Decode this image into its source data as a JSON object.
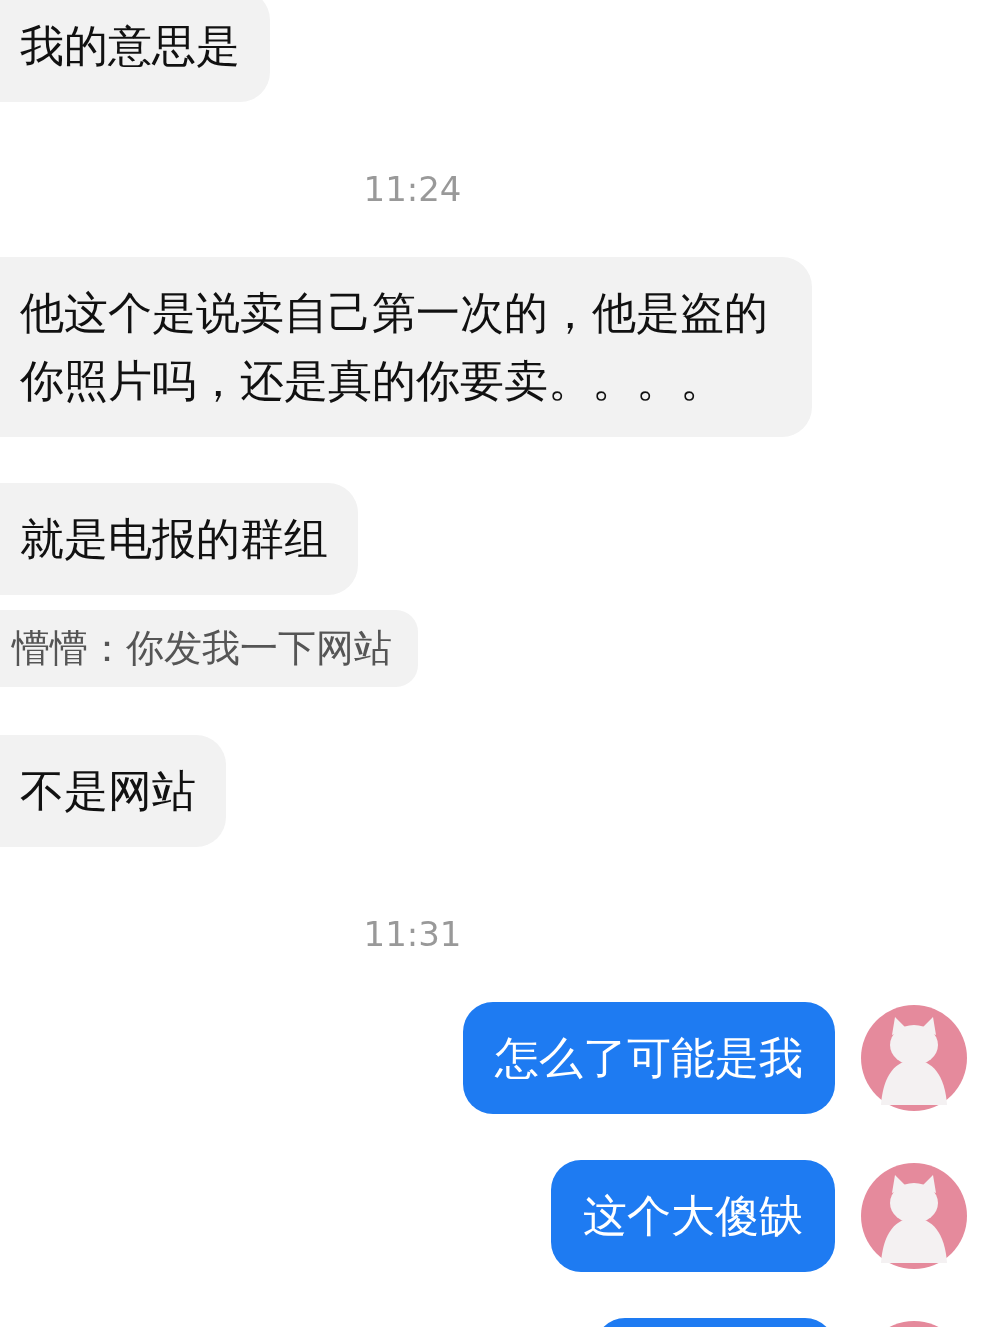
{
  "messages": [
    {
      "kind": "incoming",
      "text": "我的意思是"
    },
    {
      "kind": "time",
      "text": "11:24"
    },
    {
      "kind": "incoming",
      "text": "他这个是说卖自己第一次的，他是盗的你照片吗，还是真的你要卖。。。。"
    },
    {
      "kind": "incoming",
      "text": "就是电报的群组"
    },
    {
      "kind": "quote",
      "text": "懵懵：你发我一下网站"
    },
    {
      "kind": "incoming",
      "text": "不是网站"
    },
    {
      "kind": "time",
      "text": "11:31"
    },
    {
      "kind": "outgoing",
      "text": "怎么了可能是我"
    },
    {
      "kind": "outgoing",
      "text": "这个大傻缺"
    },
    {
      "kind": "outgoing"
    }
  ]
}
